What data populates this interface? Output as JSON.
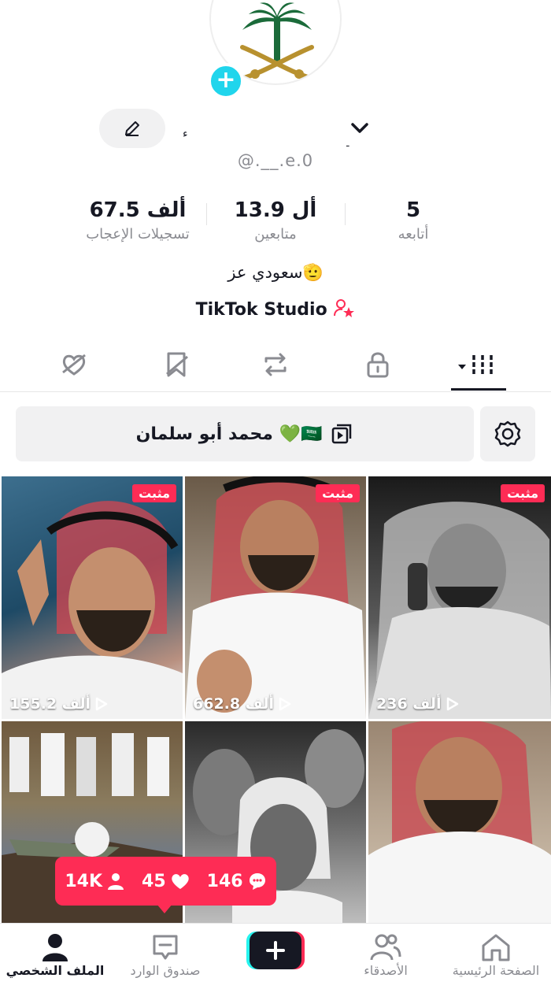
{
  "profile": {
    "avatar_icon": "saudi-emblem-icon",
    "name_mark": "ء",
    "name_dot": "ـ",
    "username": "@.__.e.0",
    "stats": [
      {
        "value": "67.5 ألف",
        "label": "تسجيلات الإعجاب"
      },
      {
        "value": "13.9 أل",
        "label": "متابعين"
      },
      {
        "value": "5",
        "label": "أتابعه"
      }
    ],
    "bio": "سعودي عز🫡",
    "studio_label": "TikTok Studio"
  },
  "tabs": [
    {
      "name": "liked",
      "icon": "heart-hidden-icon"
    },
    {
      "name": "favorites",
      "icon": "bookmark-hidden-icon"
    },
    {
      "name": "reposts",
      "icon": "repost-icon"
    },
    {
      "name": "private",
      "icon": "lock-icon"
    },
    {
      "name": "videos",
      "icon": "grid-icon",
      "active": true
    }
  ],
  "playlist": {
    "label": "محمد أبو سلمان 💚🇸🇦"
  },
  "videos": [
    {
      "pinned_label": "مثبت",
      "views": "155.2 ألف"
    },
    {
      "pinned_label": "مثبت",
      "views": "662.8 ألف"
    },
    {
      "pinned_label": "مثبت",
      "views": "236 ألف"
    },
    {
      "pinned_label": "",
      "views": ""
    },
    {
      "pinned_label": "",
      "views": ""
    },
    {
      "pinned_label": "",
      "views": ""
    }
  ],
  "notification": {
    "followers": "14K",
    "likes": "45",
    "comments": "146"
  },
  "bottom_nav": {
    "profile": "الملف الشخصي",
    "inbox": "صندوق الوارد",
    "friends": "الأصدقاء",
    "home": "الصفحة الرئيسية"
  },
  "colors": {
    "accent": "#fe2c55",
    "cyan": "#20d5ec",
    "text": "#161823",
    "muted": "#8a8b91"
  }
}
